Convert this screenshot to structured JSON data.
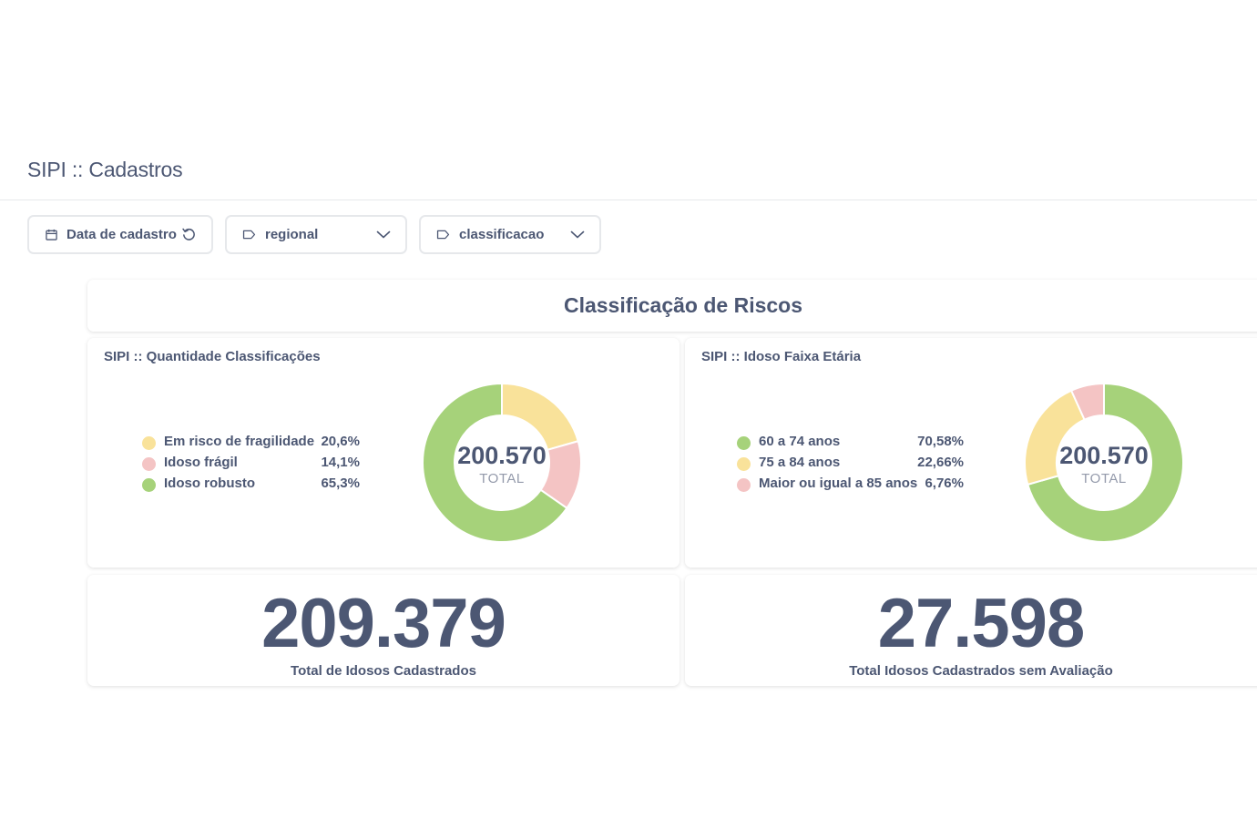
{
  "dashboard": {
    "title": "SIPI :: Cadastros"
  },
  "filters": {
    "date": {
      "label": "Data de cadastro",
      "icon": "calendar-icon",
      "reset_icon": "reset-icon"
    },
    "regional": {
      "label": "regional",
      "icon": "tag-icon",
      "chevron": "chevron-down-icon"
    },
    "classificacao": {
      "label": "classificacao",
      "icon": "tag-icon",
      "chevron": "chevron-down-icon"
    }
  },
  "section": {
    "heading": "Classificação de Riscos"
  },
  "colors": {
    "yellow": "#f9e29a",
    "pink": "#f4c4c4",
    "green": "#a6d27a",
    "text": "#4c5773",
    "muted": "#949aab"
  },
  "charts": [
    {
      "title": "SIPI :: Quantidade Classificações",
      "total_value": "200.570",
      "total_caption": "TOTAL",
      "legend": [
        {
          "label": "Em risco de fragilidade",
          "pct": "20,6%",
          "color": "#f9e29a"
        },
        {
          "label": "Idoso frágil",
          "pct": "14,1%",
          "color": "#f4c4c4"
        },
        {
          "label": "Idoso robusto",
          "pct": "65,3%",
          "color": "#a6d27a"
        }
      ]
    },
    {
      "title": "SIPI :: Idoso Faixa Etária",
      "total_value": "200.570",
      "total_caption": "TOTAL",
      "legend": [
        {
          "label": "60 a 74 anos",
          "pct": "70,58%",
          "color": "#a6d27a"
        },
        {
          "label": "75 a 84 anos",
          "pct": "22,66%",
          "color": "#f9e29a"
        },
        {
          "label": "Maior ou igual a 85 anos",
          "pct": "6,76%",
          "color": "#f4c4c4"
        }
      ]
    }
  ],
  "chart_data": [
    {
      "type": "pie",
      "title": "SIPI :: Quantidade Classificações",
      "categories": [
        "Em risco de fragilidade",
        "Idoso frágil",
        "Idoso robusto"
      ],
      "values": [
        20.6,
        14.1,
        65.3
      ],
      "colors": [
        "#f9e29a",
        "#f4c4c4",
        "#a6d27a"
      ],
      "total": "200.570",
      "legend_position": "left"
    },
    {
      "type": "pie",
      "title": "SIPI :: Idoso Faixa Etária",
      "categories": [
        "60 a 74 anos",
        "75 a 84 anos",
        "Maior ou igual a 85 anos"
      ],
      "values": [
        70.58,
        22.66,
        6.76
      ],
      "colors": [
        "#a6d27a",
        "#f9e29a",
        "#f4c4c4"
      ],
      "total": "200.570",
      "legend_position": "left"
    }
  ],
  "scalars": [
    {
      "value": "209.379",
      "label": "Total de Idosos Cadastrados"
    },
    {
      "value": "27.598",
      "label": "Total Idosos Cadastrados sem Avaliação"
    }
  ]
}
